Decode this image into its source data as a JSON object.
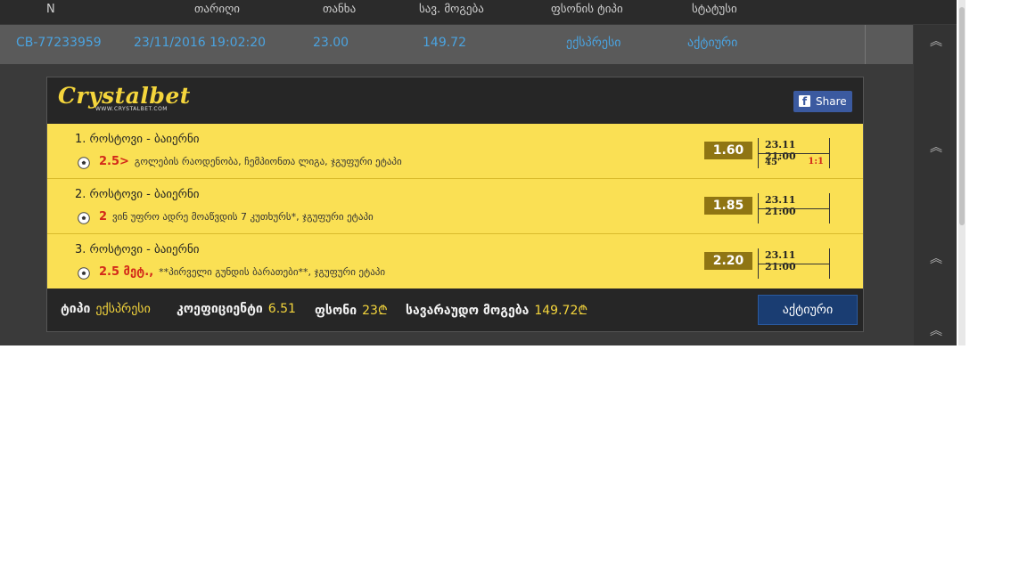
{
  "columns": {
    "n": "N",
    "date": "თარიღი",
    "amount": "თანხა",
    "possible_win": "სავ. მოგება",
    "bet_type": "ფსონის ტიპი",
    "status": "სტატუსი"
  },
  "bet": {
    "id": "CB-77233959",
    "date": "23/11/2016 19:02:20",
    "amount": "23.00",
    "possible_win": "149.72",
    "bet_type": "ექსპრესი",
    "status": "აქტიური"
  },
  "brand": {
    "name": "Crystalbet",
    "url": "WWW.CRYSTALBET.COM",
    "accent_color": "#f4d53c",
    "panel_yellow": "#fae054"
  },
  "share_label": "Share",
  "events": [
    {
      "title": "1. როსტოვი - ბაიერნი",
      "highlight": "2.5>",
      "detail": "გოლების რაოდენობა, ჩემპიონთა ლიგა, ჯგუფური ეტაპი",
      "odd": "1.60",
      "datetime": "23.11 21:00",
      "minute": "45'",
      "score": "1:1",
      "icon": "soccer-ball-icon"
    },
    {
      "title": "2. როსტოვი - ბაიერნი",
      "highlight": "2",
      "detail": "ვინ უფრო ადრე მოაწვდის 7 კუთხურს*, ჯგუფური ეტაპი",
      "odd": "1.85",
      "datetime": "23.11 21:00",
      "minute": "",
      "score": "",
      "icon": "soccer-ball-icon"
    },
    {
      "title": "3. როსტოვი - ბაიერნი",
      "highlight": "2.5 მეტ.,",
      "detail": "**პირველი გუნდის ბარათები**, ჯგუფური ეტაპი",
      "odd": "2.20",
      "datetime": "23.11 21:00",
      "minute": "",
      "score": "",
      "icon": "soccer-ball-icon"
    }
  ],
  "summary": {
    "type_label": "ტიპი",
    "type_value": "ექსპრესი",
    "coef_label": "კოეფიციენტი",
    "coef_value": "6.51",
    "stake_label": "ფსონი",
    "stake_value": "23₾",
    "win_label": "სავარაუდო მოგება",
    "win_value": "149.72₾",
    "status_button": "აქტიური"
  },
  "icons": {
    "collapse": "chevron-double-up-icon",
    "facebook": "facebook-icon"
  }
}
